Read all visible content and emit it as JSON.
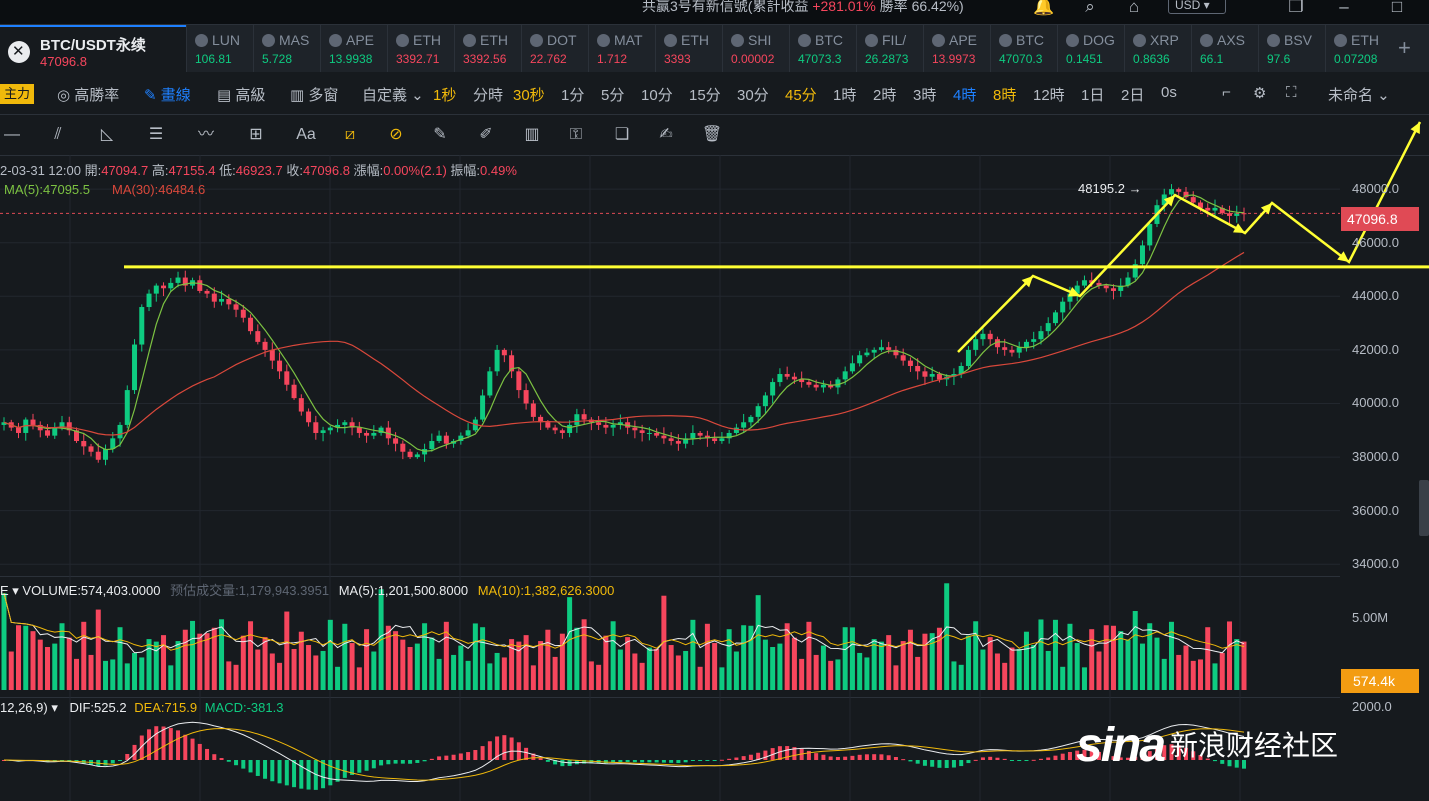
{
  "topbar": {
    "banner_prefix": "共赢3号有新信號(累計收益 ",
    "banner_gain": "+281.01%",
    "banner_suffix": " 勝率 66.42%)",
    "currency": "USD ▾"
  },
  "pair": {
    "name": "BTC/USDT永续",
    "price": "47096.8"
  },
  "tickers": [
    {
      "name": "LUN",
      "price": "106.81",
      "dir": "up",
      "icon": "coin-icon"
    },
    {
      "name": "MAS",
      "price": "5.728",
      "dir": "up",
      "icon": "coin-icon"
    },
    {
      "name": "APE",
      "price": "13.9938",
      "dir": "up",
      "icon": "coin-icon"
    },
    {
      "name": "ETH",
      "price": "3392.71",
      "dir": "dn",
      "icon": "coin-icon"
    },
    {
      "name": "ETH",
      "price": "3392.56",
      "dir": "dn",
      "icon": "coin-icon"
    },
    {
      "name": "DOT",
      "price": "22.762",
      "dir": "dn",
      "icon": "coin-icon"
    },
    {
      "name": "MAT",
      "price": "1.712",
      "dir": "dn",
      "icon": "coin-icon"
    },
    {
      "name": "ETH",
      "price": "3393",
      "dir": "dn",
      "icon": "coin-icon"
    },
    {
      "name": "SHI",
      "price": "0.00002",
      "dir": "dn",
      "icon": "coin-icon"
    },
    {
      "name": "BTC",
      "price": "47073.3",
      "dir": "up",
      "icon": "coin-icon"
    },
    {
      "name": "FIL/",
      "price": "26.2873",
      "dir": "up",
      "icon": "coin-icon"
    },
    {
      "name": "APE",
      "price": "13.9973",
      "dir": "dn",
      "icon": "coin-icon"
    },
    {
      "name": "BTC",
      "price": "47070.3",
      "dir": "up",
      "icon": "coin-icon"
    },
    {
      "name": "DOG",
      "price": "0.1451",
      "dir": "up",
      "icon": "coin-icon"
    },
    {
      "name": "XRP",
      "price": "0.8636",
      "dir": "up",
      "icon": "coin-icon"
    },
    {
      "name": "AXS",
      "price": "66.1",
      "dir": "up",
      "icon": "coin-icon"
    },
    {
      "name": "BSV",
      "price": "97.6",
      "dir": "up",
      "icon": "coin-icon"
    },
    {
      "name": "ETH",
      "price": "0.07208",
      "dir": "up",
      "icon": "coin-icon"
    }
  ],
  "toolbar": {
    "zhuli": "主力",
    "winrate": "◎ 高勝率",
    "draw": "✎ 畫線",
    "advanced": "▤ 高級",
    "multi": "▥ 多窗",
    "custom": "自定義 ⌄",
    "timeframes": [
      {
        "label": "1秒",
        "state": "hl"
      },
      {
        "label": "分時",
        "state": ""
      },
      {
        "label": "30秒",
        "state": "hl"
      },
      {
        "label": "1分",
        "state": ""
      },
      {
        "label": "5分",
        "state": ""
      },
      {
        "label": "10分",
        "state": ""
      },
      {
        "label": "15分",
        "state": ""
      },
      {
        "label": "30分",
        "state": ""
      },
      {
        "label": "45分",
        "state": "hl"
      },
      {
        "label": "1時",
        "state": ""
      },
      {
        "label": "2時",
        "state": ""
      },
      {
        "label": "3時",
        "state": ""
      },
      {
        "label": "4時",
        "state": "act"
      },
      {
        "label": "8時",
        "state": "hl"
      },
      {
        "label": "12時",
        "state": ""
      },
      {
        "label": "1日",
        "state": ""
      },
      {
        "label": "2日",
        "state": ""
      },
      {
        "label": "0s",
        "state": ""
      }
    ],
    "layout_name": "未命名 ⌄"
  },
  "info": {
    "date": "2-03-31 12:00",
    "open_label": "開:",
    "open": "47094.7",
    "high_label": "高:",
    "high": "47155.4",
    "low_label": "低:",
    "low": "46923.7",
    "close_label": "收:",
    "close": "47096.8",
    "change_label": "漲幅:",
    "change": "0.00%(2.1)",
    "amp_label": "振幅:",
    "amp": "0.49%",
    "ma5": "MA(5):47095.5",
    "ma30": "MA(30):46484.6"
  },
  "annotation": "48195.2 →",
  "price_axis": [
    "48000.0",
    "46000.0",
    "44000.0",
    "42000.0",
    "40000.0",
    "38000.0",
    "36000.0",
    "34000.0"
  ],
  "price_tag": "47096.8",
  "volume": {
    "header": "E ▾  VOLUME:574,403.0000",
    "estimate": "预估成交量:1,179,943.3951",
    "ma5": "MA(5):1,201,500.8000",
    "ma10": "MA(10):1,382,626.3000",
    "axis": "5.00M",
    "tag": "574.4k"
  },
  "macd": {
    "header": "12,26,9) ▾",
    "dif": "DIF:525.2",
    "dea": "DEA:715.9",
    "macd": "MACD:-381.3",
    "axis": "2000.0"
  },
  "watermark": {
    "logo": "sina",
    "text": "新浪财经社区"
  },
  "colors": {
    "up": "#0ecb81",
    "down": "#f6465d",
    "ma5": "#7cc242",
    "ma30": "#d9483b",
    "draw": "#ffff33",
    "accent": "#1e80ff"
  },
  "chart_data": {
    "type": "candlestick",
    "interval": "4時",
    "ylim": [
      33600,
      48900
    ],
    "yticks": [
      34000,
      36000,
      38000,
      40000,
      42000,
      44000,
      46000,
      48000
    ],
    "close": [
      39300,
      39100,
      38900,
      39400,
      39200,
      39000,
      38800,
      39100,
      39300,
      39000,
      38600,
      38400,
      38200,
      37900,
      38300,
      38700,
      39200,
      40500,
      42200,
      43600,
      44100,
      44400,
      44300,
      44500,
      44700,
      44400,
      44600,
      44200,
      44100,
      43800,
      43900,
      43700,
      43500,
      43200,
      42700,
      42300,
      42000,
      41600,
      41200,
      40700,
      40200,
      39700,
      39300,
      38900,
      39000,
      39100,
      39200,
      39300,
      39100,
      38900,
      38800,
      38900,
      39100,
      38700,
      38500,
      38200,
      38000,
      38100,
      38300,
      38600,
      38800,
      38500,
      38600,
      38800,
      39000,
      39400,
      40300,
      41200,
      42000,
      41800,
      41200,
      40500,
      40000,
      39500,
      39300,
      39100,
      39000,
      38900,
      39200,
      39600,
      39400,
      39300,
      39200,
      39100,
      39200,
      39300,
      39100,
      39000,
      38900,
      38900,
      38800,
      38700,
      38600,
      38500,
      38700,
      38900,
      38800,
      38700,
      38600,
      38700,
      38900,
      39100,
      39300,
      39500,
      39900,
      40300,
      40800,
      41100,
      41000,
      40900,
      40800,
      40700,
      40600,
      40700,
      40600,
      40900,
      41200,
      41500,
      41800,
      41900,
      42000,
      42100,
      42000,
      41800,
      41600,
      41400,
      41200,
      41000,
      41100,
      40900,
      41000,
      41100,
      41400,
      42000,
      42400,
      42600,
      42400,
      42100,
      42000,
      41900,
      42100,
      42300,
      42400,
      42700,
      43000,
      43400,
      43800,
      44100,
      44400,
      44600,
      44500,
      44400,
      44300,
      44200,
      44400,
      44700,
      45200,
      45900,
      46700,
      47400,
      47800,
      48000,
      47900,
      47700,
      47500,
      47300,
      47200,
      47300,
      47100,
      47000,
      47100,
      47096.8
    ],
    "volume_scale": "5.00M"
  }
}
